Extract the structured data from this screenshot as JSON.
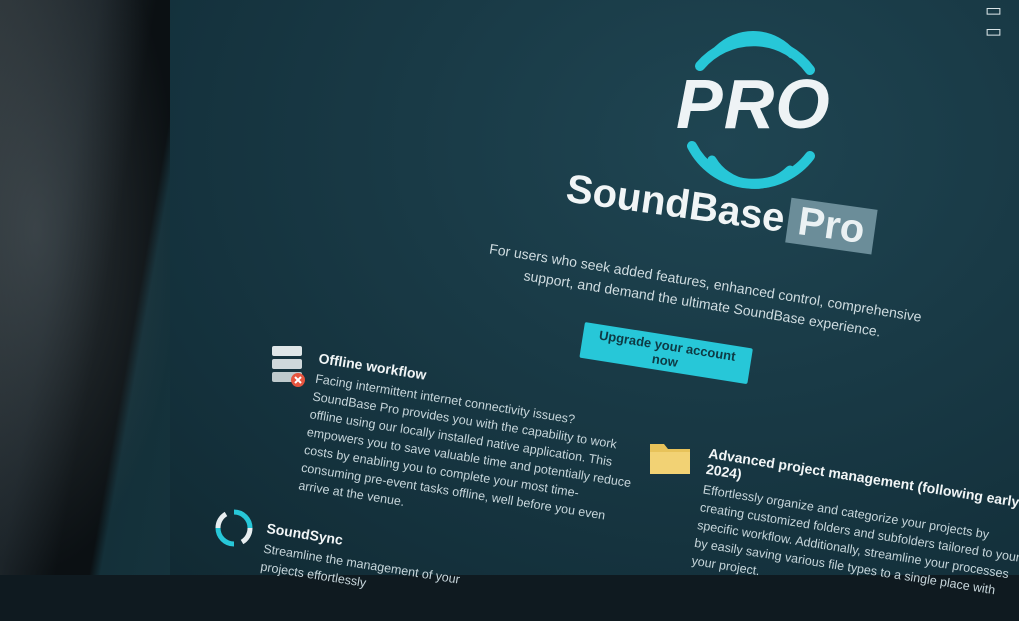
{
  "logo": {
    "text": "PRO"
  },
  "brand": {
    "name": "SoundBase",
    "badge": "Pro"
  },
  "tagline": "For users who seek added features, enhanced control, comprehensive support, and demand the ultimate SoundBase experience.",
  "cta": {
    "label": "Upgrade your account now"
  },
  "features": [
    {
      "title": "Offline workflow",
      "body": "Facing intermittent internet connectivity issues? SoundBase Pro provides you with the capability to work offline using our locally installed native application. This empowers you to save valuable time and potentially reduce costs by enabling you to complete your most time-consuming pre-event tasks offline, well before you even arrive at the venue."
    },
    {
      "title": "Advanced project management (following early 2024)",
      "body": "Effortlessly organize and categorize your projects by creating customized folders and subfolders tailored to your specific workflow. Additionally, streamline your processes by easily saving various file types to a single place with your project."
    },
    {
      "title": "SoundSync",
      "body": "Streamline the management of your projects effortlessly"
    }
  ],
  "colors": {
    "accent": "#27c7d8",
    "screen": "#183a45",
    "text": "#f1f5f6"
  },
  "icons": [
    "pro-logo-wave-icon",
    "database-error-icon",
    "folder-icon",
    "sync-icon"
  ]
}
